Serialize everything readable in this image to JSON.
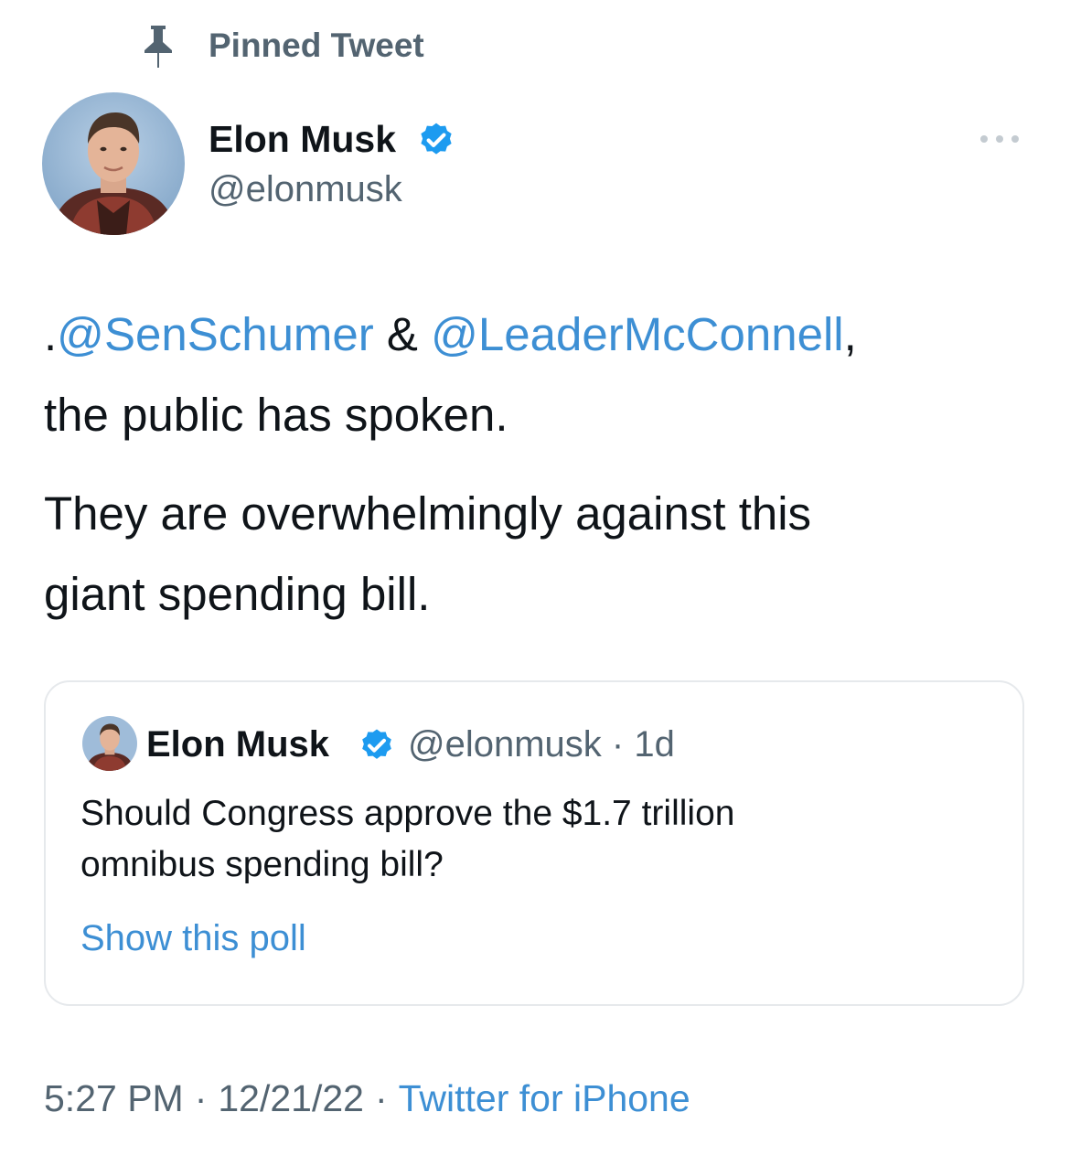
{
  "pinned": {
    "label": "Pinned Tweet",
    "icon": "pin-icon"
  },
  "author": {
    "name": "Elon Musk",
    "handle": "@elonmusk",
    "verified_icon": "verified-badge-icon",
    "avatar_icon": "avatar-photo"
  },
  "more_icon": "more-options-icon",
  "tweet": {
    "line1_prefix": ".",
    "mention1": "@SenSchumer",
    "line1_middle": " & ",
    "mention2": "@LeaderMcConnell",
    "line1_suffix": ",",
    "line2": "the public has spoken.",
    "line3": "They are overwhelmingly against this",
    "line4": "giant spending bill."
  },
  "quote": {
    "name": "Elon Musk",
    "handle": "@elonmusk",
    "time": "1d",
    "text_line1": "Should Congress approve the $1.7 trillion",
    "text_line2": "omnibus spending bill?",
    "poll_link": "Show this poll"
  },
  "footer": {
    "time": "5:27 PM",
    "date": "12/21/22",
    "separator": "·",
    "source": "Twitter for iPhone"
  },
  "colors": {
    "link": "#3d8fd4",
    "secondary_text": "#536471",
    "primary_text": "#0f1419",
    "verified": "#1d9bf0",
    "card_border": "#e6e9ec"
  }
}
